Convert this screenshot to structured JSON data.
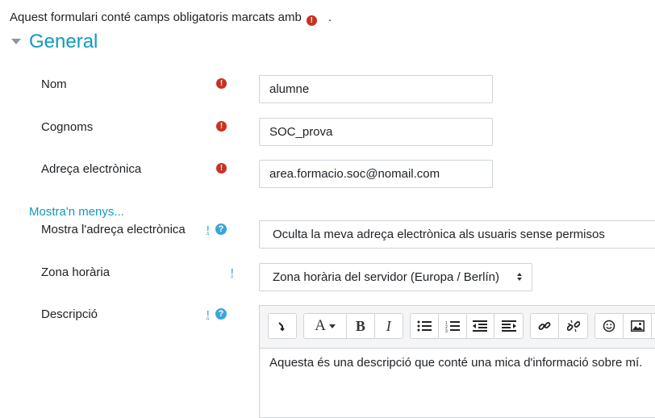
{
  "form": {
    "required_note": "Aquest formulari conté camps obligatoris marcats amb",
    "required_note_end": ".",
    "section_title": "General",
    "show_less": "Mostra'n menys...",
    "required_icon": "!",
    "advanced_mark": "!",
    "help_icon": "?"
  },
  "fields": {
    "nom": {
      "label": "Nom",
      "value": "alumne"
    },
    "cognoms": {
      "label": "Cognoms",
      "value": "SOC_prova"
    },
    "email": {
      "label": "Adreça electrònica",
      "value": "area.formacio.soc@nomail.com"
    },
    "mostra_email": {
      "label": "Mostra l'adreça electrònica",
      "value": "Oculta la meva adreça electrònica als usuaris sense permisos"
    },
    "zona": {
      "label": "Zona horària",
      "value": "Zona horària del servidor (Europa / Berlín)"
    },
    "descripcio": {
      "label": "Descripció",
      "text": "Aquesta és una descripció que conté una mica d'informació sobre mí."
    }
  },
  "toolbar": {
    "icons": [
      "collapse-icon",
      "font-color-icon",
      "bold-icon",
      "italic-icon",
      "unordered-list-icon",
      "ordered-list-icon",
      "outdent-icon",
      "indent-icon",
      "link-icon",
      "unlink-icon",
      "emoji-icon",
      "image-icon"
    ],
    "bold": "B",
    "italic": "I",
    "font": "A"
  },
  "colors": {
    "accent": "#0f9bbf",
    "required": "#ca3120",
    "help": "#3aa6d8"
  }
}
